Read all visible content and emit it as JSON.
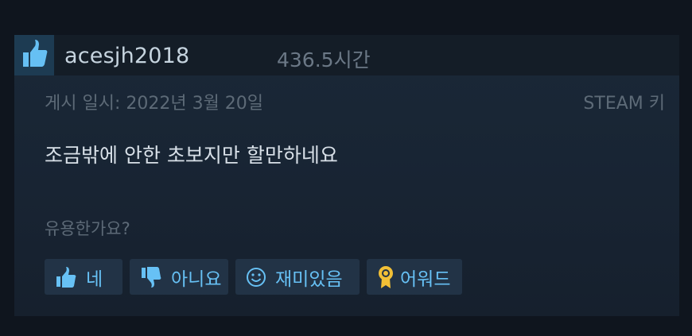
{
  "review": {
    "username": "acesjh2018",
    "hours": "436.5시간",
    "posted": "게시 일시: 2022년 3월 20일",
    "source": "STEAM 키",
    "body": "조금밖에 안한 초보지만 할만하네요",
    "helpful_question": "유용한가요?",
    "buttons": {
      "yes": "네",
      "no": "아니요",
      "funny": "재미있음",
      "award": "어워드"
    }
  },
  "icons": {
    "recommended": "thumbs-up-icon",
    "yes": "thumbs-up-icon",
    "no": "thumbs-down-icon",
    "funny": "smiley-icon",
    "award": "award-ribbon-icon"
  },
  "colors": {
    "background": "#0f151e",
    "link": "#67c1f5",
    "award": "#f2c036",
    "thumb": "#66c0f4"
  }
}
